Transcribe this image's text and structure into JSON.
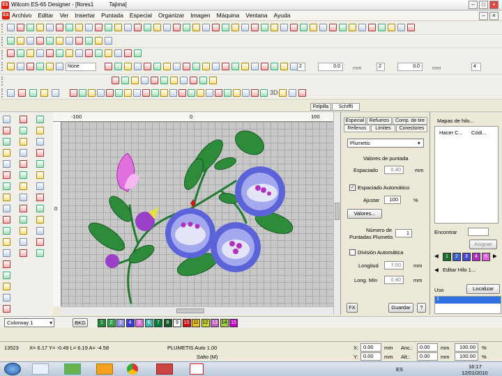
{
  "window": {
    "title": "Wilcom ES-65 Designer - [flores1          Tajima]",
    "app_badge": "ES"
  },
  "menu": [
    "Archivo",
    "Editar",
    "Ver",
    "Insertar",
    "Puntada",
    "Especial",
    "Organizar",
    "Imagen",
    "Máquina",
    "Ventana",
    "Ayuda"
  ],
  "toolbar": {
    "color_dropdown": "None",
    "spin1": "2",
    "spin1_val": "0.0",
    "spin1_unit": "mm",
    "spin2": "2",
    "spin2_val": "0.0",
    "spin2_unit": "mm",
    "spin3": "4",
    "label_3d": "3D"
  },
  "ruler": {
    "top_left": "-100",
    "top_mid": "0",
    "top_right": "100",
    "left_mid": "0"
  },
  "panel": {
    "docktabs": [
      "Felpilla",
      "Schiffli"
    ],
    "tabs_row1": [
      "Especial",
      "Refuerzo",
      "Comp. de tire"
    ],
    "tabs_row2": [
      "Rellenos",
      "Límites",
      "Conectores"
    ],
    "fill_type": "Plumetis",
    "valores_title": "Valores de puntada",
    "espaciado_label": "Espaciado",
    "espaciado_val": "0.40",
    "espaciado_unit": "mm",
    "auto_label": "Espaciado Automático",
    "ajustar_label": "Ajustar",
    "ajustar_val": "100",
    "ajustar_unit": "%",
    "valores_btn": "Valores...",
    "num_label_1": "Número de",
    "num_label_2": "Puntadas Plumetis",
    "num_val": "1",
    "division_label": "División Automática",
    "longitud_label": "Longitud",
    "longitud_val": "7.00",
    "longitud_unit": "mm",
    "longmin_label": "Long. Mín",
    "longmin_val": "0.40",
    "longmin_unit": "mm",
    "fx_btn": "FX",
    "guardar_btn": "Guardar",
    "help_btn": "?"
  },
  "threads": {
    "title": "Mapas de hilo...",
    "col1": "Hacer C...",
    "col2": "Códi...",
    "encontrar_label": "Encontrar",
    "asignar_btn": "Asignar",
    "swatches": [
      "1",
      "2",
      "3",
      "4",
      "5"
    ],
    "swatch_colors": [
      "#1f6e2e",
      "#3a5cc8",
      "#4a4ad0",
      "#b030c0",
      "#e060e0"
    ],
    "editar_btn": "Editar Hilo 1...",
    "uso_label": "Uso",
    "localizar_btn": "Localizar",
    "uso_selected": "1"
  },
  "colorbar": {
    "colorway": "Colorway 1",
    "bkg": "BKG",
    "swatches": [
      "1",
      "2",
      "3",
      "4",
      "5",
      "6",
      "7",
      "8",
      "9",
      "10",
      "11",
      "12",
      "13",
      "14",
      "15"
    ],
    "colors": [
      "#1f8a3a",
      "#2fa84a",
      "#8f90e0",
      "#3a3ad8",
      "#e070e0",
      "#49b9b0",
      "#0a7a3a",
      "#1a5a2a",
      "#ffffff",
      "#d01010",
      "#e8c020",
      "#c8d030",
      "#c060c0",
      "#a0ca40",
      "#c000c0"
    ]
  },
  "status": {
    "count": "13523",
    "coords": "X=  6.17 Y= -0.49 L=  6.19 A=  -4.58",
    "stitch": "PLUMETIS Auto  1.00",
    "salto": "Salto (M)",
    "x_label": "X:",
    "x_val": "0.00",
    "y_label": "Y:",
    "y_val": "0.00",
    "anc_label": "Anc.:",
    "anc_val": "0.00",
    "alt_label": "Alt.:",
    "alt_val": "0.00",
    "unit_mm": "mm",
    "pct1": "100.00",
    "pct2": "100.00",
    "pct_unit": "%"
  },
  "taskbar": {
    "lang": "ES",
    "time": "16:17",
    "date": "12/01/2010"
  }
}
